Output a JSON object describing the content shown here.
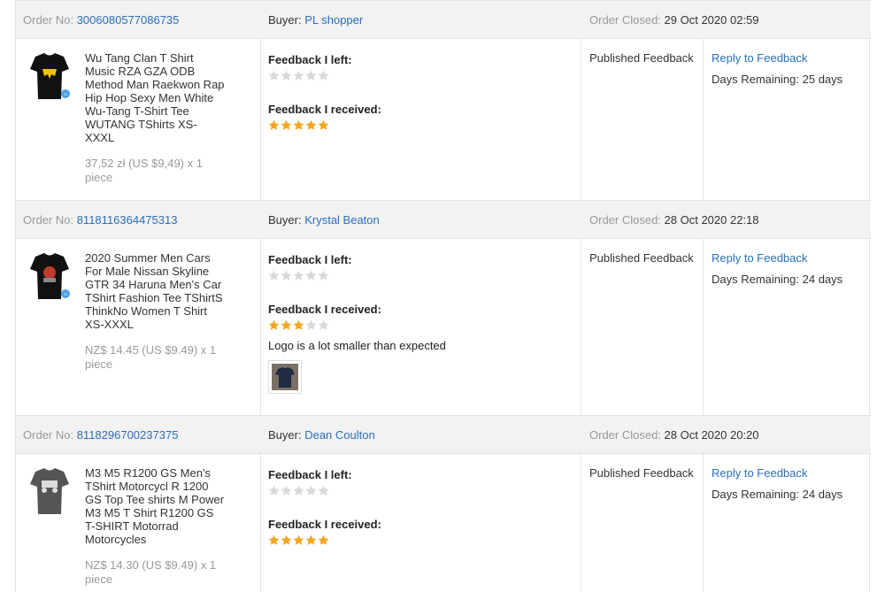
{
  "labels": {
    "order_no": "Order No:",
    "buyer": "Buyer:",
    "order_closed": "Order Closed:",
    "feedback_left": "Feedback I left:",
    "feedback_received": "Feedback I received:",
    "published": "Published Feedback",
    "reply": "Reply to Feedback",
    "days_prefix": "Days Remaining:"
  },
  "colors": {
    "star_filled": "#f5a623",
    "star_empty": "#d9d9d9",
    "link": "#2a6ebb"
  },
  "orders": [
    {
      "order_no": "3006080577086735",
      "buyer": "PL shopper",
      "closed": "29 Oct 2020 02:59",
      "title": "Wu Tang Clan T Shirt Music RZA GZA ODB Method Man Raekwon Rap Hip Hop Sexy Men White Wu-Tang T-Shirt Tee WUTANG TShirts XS-XXXL",
      "price": "37,52 zł (US $9,49) x 1 piece",
      "thumb_icon": "black-tshirt-wu-tang-icon",
      "feedback_left_stars": 0,
      "feedback_received_stars": 5,
      "comment": "",
      "days_remaining": "25 days"
    },
    {
      "order_no": "8118116364475313",
      "buyer": "Krystal Beaton",
      "closed": "28 Oct 2020 22:18",
      "title": "2020 Summer Men Cars For Male Nissan Skyline GTR 34 Haruna Men's Car TShirt Fashion Tee TShirtS ThinkNo Women T Shirt XS-XXXL",
      "price": "NZ$ 14.45 (US $9.49) x 1 piece",
      "thumb_icon": "black-tshirt-car-icon",
      "feedback_left_stars": 0,
      "feedback_received_stars": 3,
      "comment": "Logo is a lot smaller than expected",
      "days_remaining": "24 days"
    },
    {
      "order_no": "8118296700237375",
      "buyer": "Dean Coulton",
      "closed": "28 Oct 2020 20:20",
      "title": "M3 M5 R1200 GS Men's TShirt Motorcycl R 1200 GS Top Tee shirts M Power M3 M5 T Shirt R1200 GS T-SHIRT Motorrad Motorcycles",
      "price": "NZ$ 14.30 (US $9.49) x 1 piece",
      "thumb_icon": "grey-tshirt-motorcycle-icon",
      "feedback_left_stars": 0,
      "feedback_received_stars": 5,
      "comment": "",
      "days_remaining": "24 days"
    }
  ]
}
